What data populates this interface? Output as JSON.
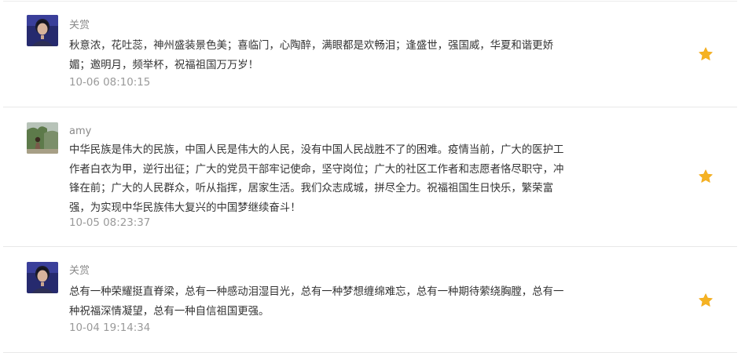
{
  "comments": [
    {
      "username": "关赏",
      "avatar": "user-photo-avatar",
      "content": "秋意浓，花吐蕊，神州盛装景色美；喜临门，心陶醉，满眼都是欢畅泪；逢盛世，强国威，华夏和谐更娇媚；邀明月，频举杯，祝福祖国万万岁！",
      "time": "10-06 08:10:15",
      "favorite_icon": "star-icon",
      "favorite_color": "#f5b223"
    },
    {
      "username": "amy",
      "avatar": "user-photo-avatar",
      "content": "中华民族是伟大的民族，中国人民是伟大的人民，没有中国人民战胜不了的困难。疫情当前，广大的医护工作者白衣为甲，逆行出征；广大的党员干部牢记使命，坚守岗位；广大的社区工作者和志愿者恪尽职守，冲锋在前；广大的人民群众，听从指挥，居家生活。我们众志成城，拼尽全力。祝福祖国生日快乐，繁荣富强，为实现中华民族伟大复兴的中国梦继续奋斗！",
      "time": "10-05 08:23:37",
      "favorite_icon": "star-icon",
      "favorite_color": "#f5b223"
    },
    {
      "username": "关赏",
      "avatar": "user-photo-avatar",
      "content": "总有一种荣耀挺直脊梁，总有一种感动泪湿目光，总有一种梦想缠绵难忘，总有一种期待萦绕胸膛，总有一种祝福深情凝望，总有一种自信祖国更强。",
      "time": "10-04 19:14:34",
      "favorite_icon": "star-icon",
      "favorite_color": "#f5b223"
    }
  ]
}
